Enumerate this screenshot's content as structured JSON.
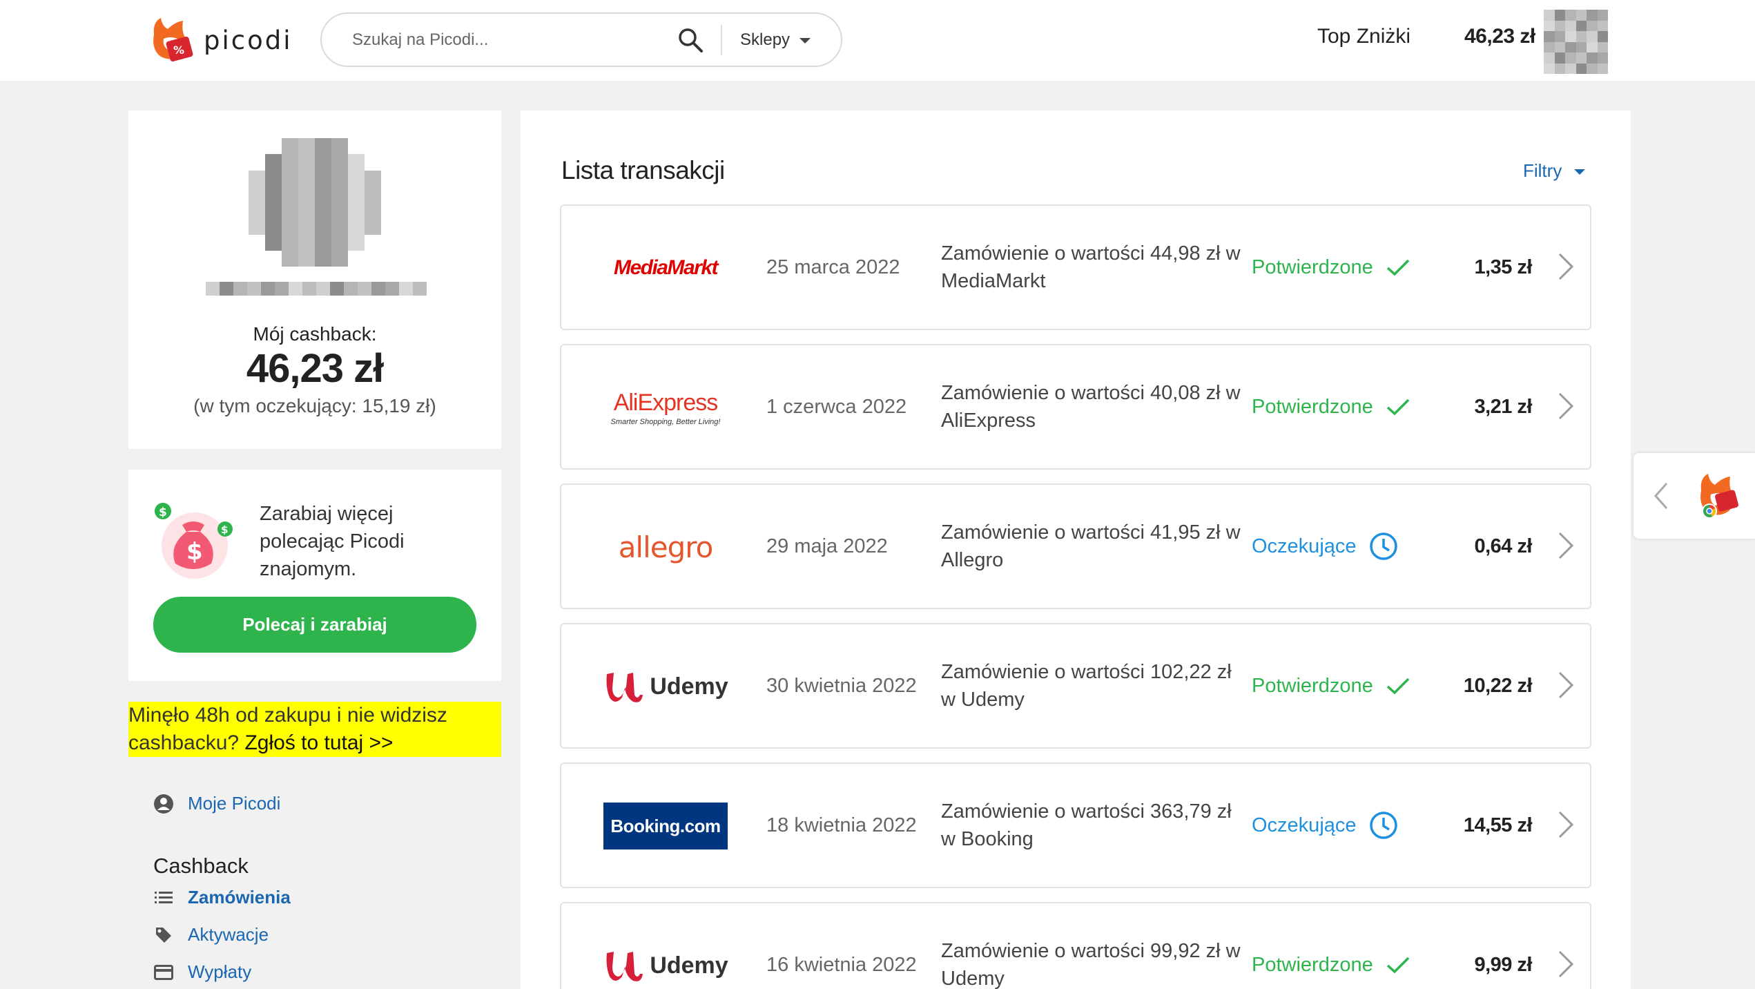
{
  "header": {
    "logo_text": "picodi",
    "search_placeholder": "Szukaj na Picodi...",
    "shops_label": "Sklepy",
    "top_discounts": "Top Zniżki",
    "balance": "46,23 zł"
  },
  "profile": {
    "cashback_label": "Mój cashback:",
    "cashback_value": "46,23 zł",
    "pending_text": "(w tym oczekujący: 15,19 zł)"
  },
  "refer": {
    "text": "Zarabiaj więcej polecając Picodi znajomym.",
    "button": "Polecaj i zarabiaj"
  },
  "notice": {
    "text": "Minęło 48h od zakupu i nie widzisz cashbacku? ",
    "link": "Zgłoś to tutaj >>"
  },
  "menu": {
    "my_picodi": "Moje Picodi",
    "cashback_heading": "Cashback",
    "orders": "Zamówienia",
    "activations": "Aktywacje",
    "payouts": "Wypłaty"
  },
  "transactions": {
    "title": "Lista transakcji",
    "filters": "Filtry",
    "items": [
      {
        "store": "MediaMarkt",
        "date": "25 marca 2022",
        "description": "Zamówienie o wartości 44,98 zł w MediaMarkt",
        "status": "Potwierdzone",
        "amount": "1,35 zł"
      },
      {
        "store": "AliExpress",
        "store_tagline": "Smarter Shopping, Better Living!",
        "date": "1 czerwca 2022",
        "description": "Zamówienie o wartości 40,08 zł w AliExpress",
        "status": "Potwierdzone",
        "amount": "3,21 zł"
      },
      {
        "store": "allegro",
        "date": "29 maja 2022",
        "description": "Zamówienie o wartości 41,95 zł w Allegro",
        "status": "Oczekujące",
        "amount": "0,64 zł"
      },
      {
        "store": "Udemy",
        "date": "30 kwietnia 2022",
        "description": "Zamówienie o wartości 102,22 zł w Udemy",
        "status": "Potwierdzone",
        "amount": "10,22 zł"
      },
      {
        "store": "Booking.com",
        "date": "18 kwietnia 2022",
        "description": "Zamówienie o wartości 363,79 zł w Booking",
        "status": "Oczekujące",
        "amount": "14,55 zł"
      },
      {
        "store": "Udemy",
        "date": "16 kwietnia 2022",
        "description": "Zamówienie o wartości 99,92 zł w Udemy",
        "status": "Potwierdzone",
        "amount": "9,99 zł"
      }
    ]
  },
  "colors": {
    "confirmed": "#2db44c",
    "pending": "#1e90e0",
    "link": "#1a66b0",
    "button": "#2db44c",
    "notice_bg": "#ffff00"
  },
  "icons": [
    "search-icon",
    "chevron-down-icon",
    "check-icon",
    "clock-icon",
    "chevron-right-icon",
    "user-icon",
    "list-icon",
    "tag-icon",
    "card-icon",
    "money-bag-icon",
    "chevron-left-icon"
  ]
}
